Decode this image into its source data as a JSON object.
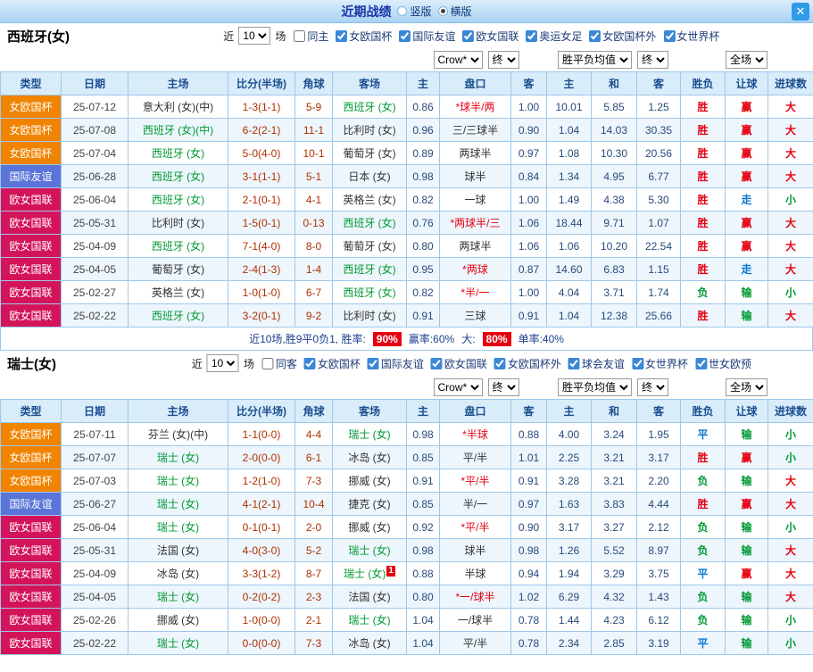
{
  "titlebar": {
    "title": "近期战绩",
    "layout_options": [
      {
        "label": "竖版",
        "selected": false
      },
      {
        "label": "横版",
        "selected": true
      }
    ],
    "close_label": "✕"
  },
  "league_colors": {
    "女欧国杯": "#f08300",
    "国际友谊": "#5b74d8",
    "欧女国联": "#d4145a"
  },
  "result_colors": {
    "胜": "#e60012",
    "负": "#009933",
    "平": "#0b76d0",
    "赢": "#e60012",
    "输": "#009933",
    "走": "#0b76d0",
    "大": "#e60012",
    "小": "#009933"
  },
  "columns": [
    "类型",
    "日期",
    "主场",
    "比分(半场)",
    "角球",
    "客场",
    "主",
    "盘口",
    "客",
    "主",
    "和",
    "客",
    "胜负",
    "让球",
    "进球数"
  ],
  "dropdowns": {
    "asia": [
      "Crow*",
      "终"
    ],
    "europe": [
      "胜平负均值",
      "终"
    ],
    "scope": [
      "全场"
    ]
  },
  "sections": [
    {
      "team_title": "西班牙(女)",
      "filter": {
        "near": "近",
        "count": "10",
        "games": "场",
        "checkboxes": [
          {
            "label": "同主",
            "checked": false
          },
          {
            "label": "女欧国杯",
            "checked": true
          },
          {
            "label": "国际友谊",
            "checked": true
          },
          {
            "label": "欧女国联",
            "checked": true
          },
          {
            "label": "奥运女足",
            "checked": true
          },
          {
            "label": "女欧国杯外",
            "checked": true
          },
          {
            "label": "女世界杯",
            "checked": true
          }
        ]
      },
      "rows": [
        {
          "league": "女欧国杯",
          "date": "25-07-12",
          "home": "意大利 (女)(中)",
          "home_focal": false,
          "score": "1-3(1-1)",
          "corner": "5-9",
          "away": "西班牙 (女)",
          "away_focal": true,
          "ah_home": "0.86",
          "handicap": "*球半/两",
          "ah_away": "1.00",
          "eu_home": "10.01",
          "eu_draw": "5.85",
          "eu_away": "1.25",
          "result": "胜",
          "let_result": "赢",
          "goals": "大"
        },
        {
          "league": "女欧国杯",
          "date": "25-07-08",
          "home": "西班牙 (女)(中)",
          "home_focal": true,
          "score": "6-2(2-1)",
          "corner": "11-1",
          "away": "比利时 (女)",
          "away_focal": false,
          "ah_home": "0.96",
          "handicap": "三/三球半",
          "ah_away": "0.90",
          "eu_home": "1.04",
          "eu_draw": "14.03",
          "eu_away": "30.35",
          "result": "胜",
          "let_result": "赢",
          "goals": "大"
        },
        {
          "league": "女欧国杯",
          "date": "25-07-04",
          "home": "西班牙 (女)",
          "home_focal": true,
          "score": "5-0(4-0)",
          "corner": "10-1",
          "away": "葡萄牙 (女)",
          "away_focal": false,
          "ah_home": "0.89",
          "handicap": "两球半",
          "ah_away": "0.97",
          "eu_home": "1.08",
          "eu_draw": "10.30",
          "eu_away": "20.56",
          "result": "胜",
          "let_result": "赢",
          "goals": "大"
        },
        {
          "league": "国际友谊",
          "date": "25-06-28",
          "home": "西班牙 (女)",
          "home_focal": true,
          "score": "3-1(1-1)",
          "corner": "5-1",
          "away": "日本 (女)",
          "away_focal": false,
          "ah_home": "0.98",
          "handicap": "球半",
          "ah_away": "0.84",
          "eu_home": "1.34",
          "eu_draw": "4.95",
          "eu_away": "6.77",
          "result": "胜",
          "let_result": "赢",
          "goals": "大"
        },
        {
          "league": "欧女国联",
          "date": "25-06-04",
          "home": "西班牙 (女)",
          "home_focal": true,
          "score": "2-1(0-1)",
          "corner": "4-1",
          "away": "英格兰 (女)",
          "away_focal": false,
          "ah_home": "0.82",
          "handicap": "一球",
          "ah_away": "1.00",
          "eu_home": "1.49",
          "eu_draw": "4.38",
          "eu_away": "5.30",
          "result": "胜",
          "let_result": "走",
          "goals": "小"
        },
        {
          "league": "欧女国联",
          "date": "25-05-31",
          "home": "比利时 (女)",
          "home_focal": false,
          "score": "1-5(0-1)",
          "corner": "0-13",
          "away": "西班牙 (女)",
          "away_focal": true,
          "ah_home": "0.76",
          "handicap": "*两球半/三",
          "ah_away": "1.06",
          "eu_home": "18.44",
          "eu_draw": "9.71",
          "eu_away": "1.07",
          "result": "胜",
          "let_result": "赢",
          "goals": "大"
        },
        {
          "league": "欧女国联",
          "date": "25-04-09",
          "home": "西班牙 (女)",
          "home_focal": true,
          "score": "7-1(4-0)",
          "corner": "8-0",
          "away": "葡萄牙 (女)",
          "away_focal": false,
          "ah_home": "0.80",
          "handicap": "两球半",
          "ah_away": "1.06",
          "eu_home": "1.06",
          "eu_draw": "10.20",
          "eu_away": "22.54",
          "result": "胜",
          "let_result": "赢",
          "goals": "大"
        },
        {
          "league": "欧女国联",
          "date": "25-04-05",
          "home": "葡萄牙 (女)",
          "home_focal": false,
          "score": "2-4(1-3)",
          "corner": "1-4",
          "away": "西班牙 (女)",
          "away_focal": true,
          "ah_home": "0.95",
          "handicap": "*两球",
          "ah_away": "0.87",
          "eu_home": "14.60",
          "eu_draw": "6.83",
          "eu_away": "1.15",
          "result": "胜",
          "let_result": "走",
          "goals": "大"
        },
        {
          "league": "欧女国联",
          "date": "25-02-27",
          "home": "英格兰 (女)",
          "home_focal": false,
          "score": "1-0(1-0)",
          "corner": "6-7",
          "away": "西班牙 (女)",
          "away_focal": true,
          "ah_home": "0.82",
          "handicap": "*半/一",
          "ah_away": "1.00",
          "eu_home": "4.04",
          "eu_draw": "3.71",
          "eu_away": "1.74",
          "result": "负",
          "let_result": "输",
          "goals": "小"
        },
        {
          "league": "欧女国联",
          "date": "25-02-22",
          "home": "西班牙 (女)",
          "home_focal": true,
          "score": "3-2(0-1)",
          "corner": "9-2",
          "away": "比利时 (女)",
          "away_focal": false,
          "ah_home": "0.91",
          "handicap": "三球",
          "ah_away": "0.91",
          "eu_home": "1.04",
          "eu_draw": "12.38",
          "eu_away": "25.66",
          "result": "胜",
          "let_result": "输",
          "goals": "大"
        }
      ],
      "summary": {
        "prefix": "近10场,胜9平0负1, 胜率:",
        "win_rate": "90%",
        "mid1": "赢率:60%",
        "mid2": "大:",
        "big_rate": "80%",
        "suffix": "单率:40%"
      }
    },
    {
      "team_title": "瑞士(女)",
      "filter": {
        "near": "近",
        "count": "10",
        "games": "场",
        "checkboxes": [
          {
            "label": "同客",
            "checked": false
          },
          {
            "label": "女欧国杯",
            "checked": true
          },
          {
            "label": "国际友谊",
            "checked": true
          },
          {
            "label": "欧女国联",
            "checked": true
          },
          {
            "label": "女欧国杯外",
            "checked": true
          },
          {
            "label": "球会友谊",
            "checked": true
          },
          {
            "label": "女世界杯",
            "checked": true
          },
          {
            "label": "世女欧预",
            "checked": true
          }
        ]
      },
      "rows": [
        {
          "league": "女欧国杯",
          "date": "25-07-11",
          "home": "芬兰 (女)(中)",
          "home_focal": false,
          "score": "1-1(0-0)",
          "corner": "4-4",
          "away": "瑞士 (女)",
          "away_focal": true,
          "ah_home": "0.98",
          "handicap": "*半球",
          "ah_away": "0.88",
          "eu_home": "4.00",
          "eu_draw": "3.24",
          "eu_away": "1.95",
          "result": "平",
          "let_result": "输",
          "goals": "小"
        },
        {
          "league": "女欧国杯",
          "date": "25-07-07",
          "home": "瑞士 (女)",
          "home_focal": true,
          "score": "2-0(0-0)",
          "corner": "6-1",
          "away": "冰岛 (女)",
          "away_focal": false,
          "ah_home": "0.85",
          "handicap": "平/半",
          "ah_away": "1.01",
          "eu_home": "2.25",
          "eu_draw": "3.21",
          "eu_away": "3.17",
          "result": "胜",
          "let_result": "赢",
          "goals": "小"
        },
        {
          "league": "女欧国杯",
          "date": "25-07-03",
          "home": "瑞士 (女)",
          "home_focal": true,
          "score": "1-2(1-0)",
          "corner": "7-3",
          "away": "挪威 (女)",
          "away_focal": false,
          "ah_home": "0.91",
          "handicap": "*平/半",
          "ah_away": "0.91",
          "eu_home": "3.28",
          "eu_draw": "3.21",
          "eu_away": "2.20",
          "result": "负",
          "let_result": "输",
          "goals": "大"
        },
        {
          "league": "国际友谊",
          "date": "25-06-27",
          "home": "瑞士 (女)",
          "home_focal": true,
          "score": "4-1(2-1)",
          "corner": "10-4",
          "away": "捷克 (女)",
          "away_focal": false,
          "ah_home": "0.85",
          "handicap": "半/一",
          "ah_away": "0.97",
          "eu_home": "1.63",
          "eu_draw": "3.83",
          "eu_away": "4.44",
          "result": "胜",
          "let_result": "赢",
          "goals": "大"
        },
        {
          "league": "欧女国联",
          "date": "25-06-04",
          "home": "瑞士 (女)",
          "home_focal": true,
          "score": "0-1(0-1)",
          "corner": "2-0",
          "away": "挪威 (女)",
          "away_focal": false,
          "ah_home": "0.92",
          "handicap": "*平/半",
          "ah_away": "0.90",
          "eu_home": "3.17",
          "eu_draw": "3.27",
          "eu_away": "2.12",
          "result": "负",
          "let_result": "输",
          "goals": "小"
        },
        {
          "league": "欧女国联",
          "date": "25-05-31",
          "home": "法国 (女)",
          "home_focal": false,
          "score": "4-0(3-0)",
          "corner": "5-2",
          "away": "瑞士 (女)",
          "away_focal": true,
          "ah_home": "0.98",
          "handicap": "球半",
          "ah_away": "0.98",
          "eu_home": "1.26",
          "eu_draw": "5.52",
          "eu_away": "8.97",
          "result": "负",
          "let_result": "输",
          "goals": "大"
        },
        {
          "league": "欧女国联",
          "date": "25-04-09",
          "home": "冰岛 (女)",
          "home_focal": false,
          "score": "3-3(1-2)",
          "corner": "8-7",
          "away": "瑞士 (女)",
          "away_focal": true,
          "away_badge": "1",
          "ah_home": "0.88",
          "handicap": "半球",
          "ah_away": "0.94",
          "eu_home": "1.94",
          "eu_draw": "3.29",
          "eu_away": "3.75",
          "result": "平",
          "let_result": "赢",
          "goals": "大"
        },
        {
          "league": "欧女国联",
          "date": "25-04-05",
          "home": "瑞士 (女)",
          "home_focal": true,
          "score": "0-2(0-2)",
          "corner": "2-3",
          "away": "法国 (女)",
          "away_focal": false,
          "ah_home": "0.80",
          "handicap": "*一/球半",
          "ah_away": "1.02",
          "eu_home": "6.29",
          "eu_draw": "4.32",
          "eu_away": "1.43",
          "result": "负",
          "let_result": "输",
          "goals": "大"
        },
        {
          "league": "欧女国联",
          "date": "25-02-26",
          "home": "挪威 (女)",
          "home_focal": false,
          "score": "1-0(0-0)",
          "corner": "2-1",
          "away": "瑞士 (女)",
          "away_focal": true,
          "ah_home": "1.04",
          "handicap": "一/球半",
          "ah_away": "0.78",
          "eu_home": "1.44",
          "eu_draw": "4.23",
          "eu_away": "6.12",
          "result": "负",
          "let_result": "输",
          "goals": "小"
        },
        {
          "league": "欧女国联",
          "date": "25-02-22",
          "home": "瑞士 (女)",
          "home_focal": true,
          "score": "0-0(0-0)",
          "corner": "7-3",
          "away": "冰岛 (女)",
          "away_focal": false,
          "ah_home": "1.04",
          "handicap": "平/半",
          "ah_away": "0.78",
          "eu_home": "2.34",
          "eu_draw": "2.85",
          "eu_away": "3.19",
          "result": "平",
          "let_result": "输",
          "goals": "小"
        }
      ]
    }
  ]
}
